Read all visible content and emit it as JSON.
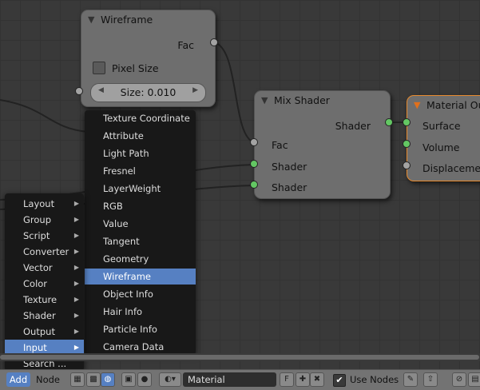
{
  "nodes": {
    "wireframe": {
      "title": "Wireframe",
      "output_fac": "Fac",
      "checkbox_label": "Pixel Size",
      "size_field": "Size: 0.010"
    },
    "mix_shader": {
      "title": "Mix Shader",
      "output": "Shader",
      "inputs": [
        "Fac",
        "Shader",
        "Shader"
      ]
    },
    "material_output": {
      "title": "Material Ou",
      "inputs": [
        "Surface",
        "Volume",
        "Displaceme"
      ]
    }
  },
  "add_menu": {
    "items": [
      {
        "label": "Layout"
      },
      {
        "label": "Group"
      },
      {
        "label": "Script"
      },
      {
        "label": "Converter"
      },
      {
        "label": "Vector"
      },
      {
        "label": "Color"
      },
      {
        "label": "Texture"
      },
      {
        "label": "Shader"
      },
      {
        "label": "Output"
      },
      {
        "label": "Input"
      }
    ],
    "search": "Search ..."
  },
  "input_submenu": {
    "items": [
      "Texture Coordinate",
      "Attribute",
      "Light Path",
      "Fresnel",
      "LayerWeight",
      "RGB",
      "Value",
      "Tangent",
      "Geometry",
      "Wireframe",
      "Object Info",
      "Hair Info",
      "Particle Info",
      "Camera Data"
    ],
    "selected": "Wireframe"
  },
  "toolbar": {
    "add": "Add",
    "node": "Node",
    "material": "Material",
    "fake_user": "F",
    "use_nodes": "Use Nodes"
  },
  "colors": {
    "selection": "#5680c2",
    "socket_shader": "#63c763",
    "socket_value": "#a3a3a3",
    "active_node": "#e78a2e"
  }
}
